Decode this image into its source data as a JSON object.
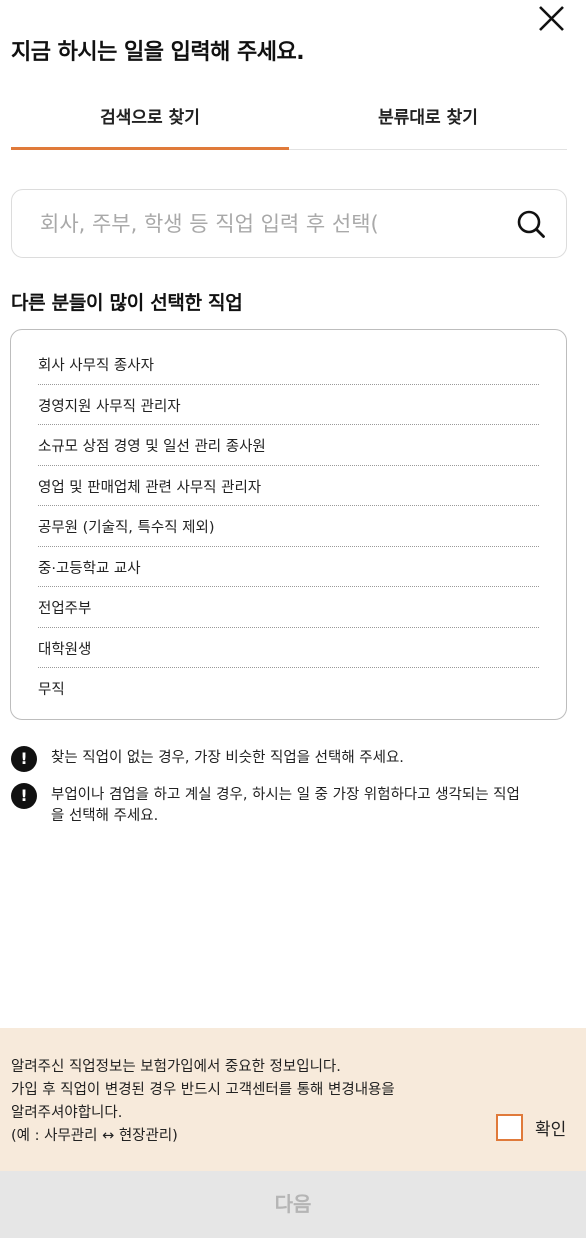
{
  "header": {
    "title": "지금 하시는 일을 입력해 주세요.",
    "close_icon": "close-icon"
  },
  "tabs": [
    {
      "label": "검색으로 찾기",
      "active": true
    },
    {
      "label": "분류대로 찾기",
      "active": false
    }
  ],
  "search": {
    "value": "",
    "placeholder": "회사, 주부, 학생 등 직업 입력 후 선택(",
    "icon": "search-icon"
  },
  "popular": {
    "title": "다른 분들이 많이 선택한 직업",
    "items": [
      "회사 사무직 종사자",
      "경영지원 사무직 관리자",
      "소규모 상점 경영 및 일선 관리 종사원",
      "영업 및 판매업체 관련 사무직 관리자",
      "공무원 (기술직, 특수직 제외)",
      "중·고등학교 교사",
      "전업주부",
      "대학원생",
      "무직"
    ]
  },
  "notices": [
    {
      "icon": "!",
      "text": "찾는 직업이 없는 경우, 가장 비슷한 직업을 선택해 주세요."
    },
    {
      "icon": "!",
      "text": "부업이나 겸업을 하고 계실 경우, 하시는 일 중 가장 위험하다고 생각되는 직업을 선택해 주세요."
    }
  ],
  "info": {
    "lines": [
      "알려주신 직업정보는 보험가입에서 중요한 정보입니다.",
      "가입 후 직업이 변경된 경우 반드시 고객센터를 통해 변경내용을",
      "알려주셔야합니다.",
      "(예 : 사무관리 ↔ 현장관리)"
    ],
    "confirm_label": "확인",
    "confirm_checked": false
  },
  "next_button": "다음",
  "colors": {
    "accent": "#e07a3a",
    "info_background": "#f7eadb",
    "disabled_button": "#e6e6e6"
  }
}
